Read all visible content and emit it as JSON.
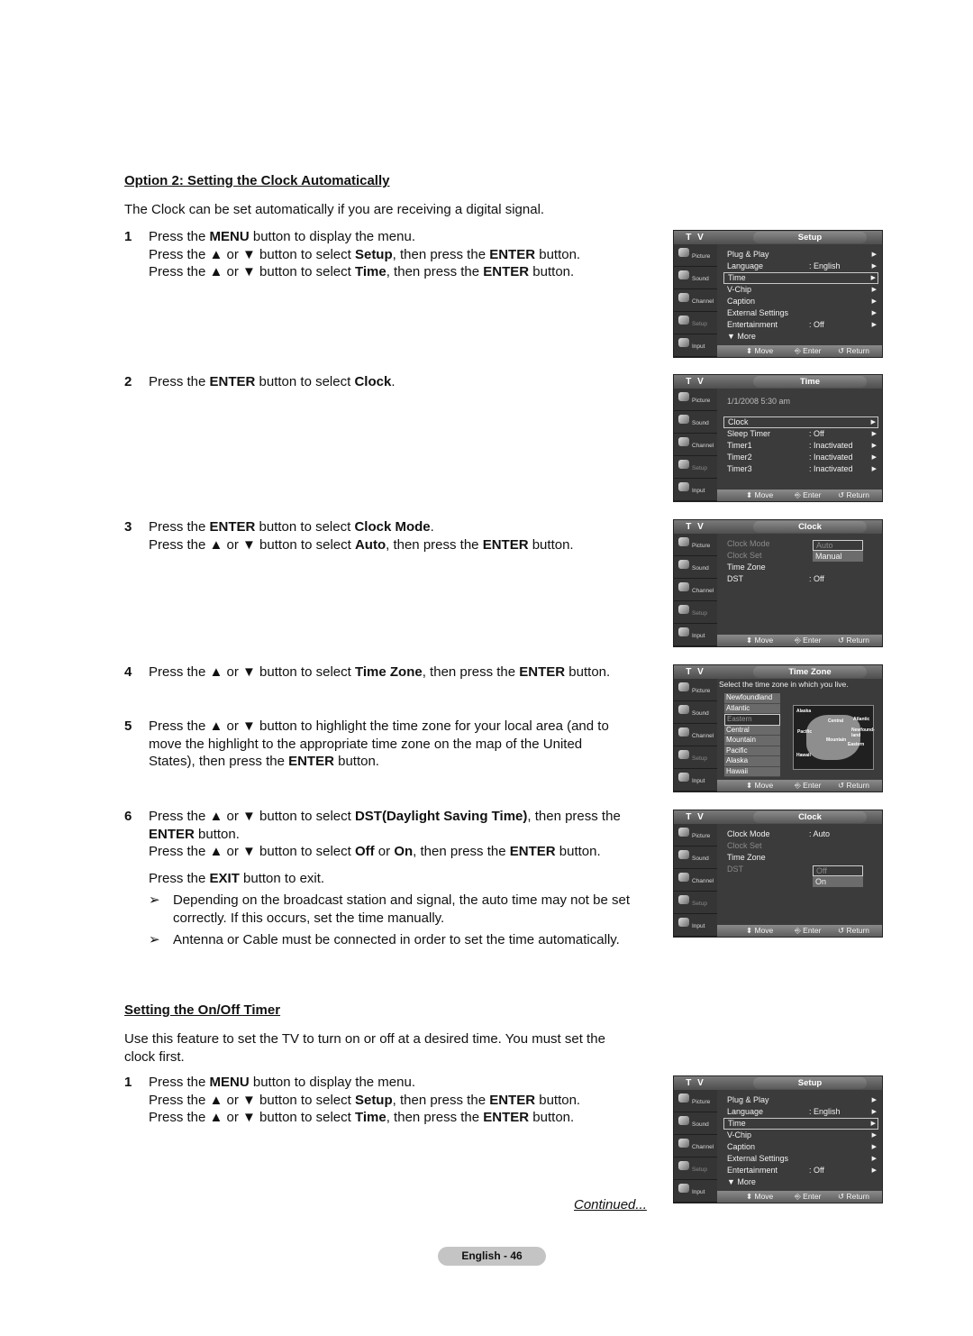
{
  "section1": {
    "heading": "Option 2: Setting the Clock Automatically",
    "intro": "The Clock can be set automatically if you are receiving a digital signal.",
    "steps": [
      {
        "num": "1",
        "lines": [
          [
            "Press the ",
            {
              "b": "MENU"
            },
            " button to display the menu."
          ],
          [
            "Press the ▲ or ▼ button to select ",
            {
              "b": "Setup"
            },
            ", then press the ",
            {
              "b": "ENTER"
            },
            " button."
          ],
          [
            "Press the ▲ or ▼ button to select ",
            {
              "b": "Time"
            },
            ", then press the ",
            {
              "b": "ENTER"
            },
            " button."
          ]
        ]
      },
      {
        "num": "2",
        "lines": [
          [
            "Press the ",
            {
              "b": "ENTER"
            },
            " button to select ",
            {
              "b": "Clock"
            },
            "."
          ]
        ]
      },
      {
        "num": "3",
        "lines": [
          [
            "Press the ",
            {
              "b": "ENTER"
            },
            " button to select ",
            {
              "b": "Clock Mode"
            },
            "."
          ],
          [
            "Press the ▲ or ▼ button to select ",
            {
              "b": "Auto"
            },
            ", then press the ",
            {
              "b": "ENTER"
            },
            " button."
          ]
        ]
      },
      {
        "num": "4",
        "lines": [
          [
            "Press the ▲ or ▼ button to select ",
            {
              "b": "Time Zone"
            },
            ", then press the ",
            {
              "b": "ENTER"
            },
            " button."
          ]
        ]
      },
      {
        "num": "5",
        "lines": [
          [
            "Press the ▲ or ▼ button to highlight the time zone for your local area (and to move the highlight to the appropriate time zone on the map of the United States), then press the ",
            {
              "b": "ENTER"
            },
            " button."
          ]
        ]
      },
      {
        "num": "6",
        "lines": [
          [
            "Press the ▲ or ▼ button to select ",
            {
              "b": "DST(Daylight Saving Time)"
            },
            ", then press the ",
            {
              "b": "ENTER"
            },
            " button."
          ],
          [
            "Press the ▲ or ▼ button to select ",
            {
              "b": "Off"
            },
            " or ",
            {
              "b": "On"
            },
            ", then press the ",
            {
              "b": "ENTER"
            },
            " button."
          ],
          [
            "__gap__"
          ],
          [
            "Press the ",
            {
              "b": "EXIT"
            },
            " button to exit."
          ]
        ],
        "notes": [
          "Depending on the broadcast station and signal, the auto time may not be set correctly. If this occurs, set the time manually.",
          "Antenna or Cable must be connected in order to set the time automatically."
        ]
      }
    ]
  },
  "section2": {
    "heading": "Setting the On/Off Timer",
    "intro": "Use this feature to set the TV to turn on or off at a desired time. You must set the clock first.",
    "steps": [
      {
        "num": "1",
        "lines": [
          [
            "Press the ",
            {
              "b": "MENU"
            },
            " button to display the menu."
          ],
          [
            "Press the ▲ or ▼ button to select ",
            {
              "b": "Setup"
            },
            ", then press the ",
            {
              "b": "ENTER"
            },
            " button."
          ],
          [
            "Press the ▲ or ▼ button to select ",
            {
              "b": "Time"
            },
            ", then press the ",
            {
              "b": "ENTER"
            },
            " button."
          ]
        ]
      }
    ]
  },
  "note_arrow": "➢",
  "continued": "Continued...",
  "page_label": "English - 46",
  "tv_common": {
    "tv_label": "T V",
    "sidebar": [
      "Picture",
      "Sound",
      "Channel",
      "Setup",
      "Input"
    ],
    "move": "⬍ Move",
    "enter": "⎆ Enter",
    "return": "↺ Return",
    "chevron": "▶",
    "more_arrow": "▼"
  },
  "screens": {
    "setup1": {
      "title": "Setup",
      "items": [
        {
          "label": "Plug & Play",
          "value": ""
        },
        {
          "label": "Language",
          "value": ": English"
        },
        {
          "label": "Time",
          "value": "",
          "selected": true
        },
        {
          "label": "V-Chip",
          "value": ""
        },
        {
          "label": "Caption",
          "value": ""
        },
        {
          "label": "External Settings",
          "value": ""
        },
        {
          "label": "Entertainment",
          "value": ": Off"
        }
      ],
      "more": "More"
    },
    "time": {
      "title": "Time",
      "datetime": "1/1/2008 5:30 am",
      "items": [
        {
          "label": "Clock",
          "value": "",
          "selected": true
        },
        {
          "label": "Sleep Timer",
          "value": ": Off"
        },
        {
          "label": "Timer1",
          "value": ": Inactivated"
        },
        {
          "label": "Timer2",
          "value": ": Inactivated"
        },
        {
          "label": "Timer3",
          "value": ": Inactivated"
        }
      ]
    },
    "clock1": {
      "title": "Clock",
      "items": [
        {
          "label": "Clock Mode",
          "value": "",
          "dim": true
        },
        {
          "label": "Clock Set",
          "value": "",
          "dim": true
        },
        {
          "label": "Time Zone",
          "value": ""
        },
        {
          "label": "DST",
          "value": ": Off"
        }
      ],
      "dropdown": [
        "Auto",
        "Manual"
      ]
    },
    "timezone": {
      "title": "Time Zone",
      "prompt": "Select the time zone in which you live.",
      "zones": [
        "Newfoundland",
        "Atlantic",
        "Eastern",
        "Central",
        "Mountain",
        "Pacific",
        "Alaska",
        "Hawaii"
      ],
      "selected": "Eastern",
      "map_labels": [
        "Alaska",
        "Pacific",
        "Central",
        "Atlantic",
        "Newfound-land",
        "Mountain",
        "Eastern",
        "Hawaii"
      ]
    },
    "clock2": {
      "title": "Clock",
      "items": [
        {
          "label": "Clock Mode",
          "value": ": Auto"
        },
        {
          "label": "Clock Set",
          "value": "",
          "dim": true
        },
        {
          "label": "Time Zone",
          "value": ""
        },
        {
          "label": "DST",
          "value": "",
          "dim": true
        }
      ],
      "dropdown": [
        "Off",
        "On"
      ]
    },
    "setup2": {
      "title": "Setup",
      "items": [
        {
          "label": "Plug & Play",
          "value": ""
        },
        {
          "label": "Language",
          "value": ": English"
        },
        {
          "label": "Time",
          "value": "",
          "selected": true
        },
        {
          "label": "V-Chip",
          "value": ""
        },
        {
          "label": "Caption",
          "value": ""
        },
        {
          "label": "External Settings",
          "value": ""
        },
        {
          "label": "Entertainment",
          "value": ": Off"
        }
      ],
      "more": "More"
    }
  }
}
